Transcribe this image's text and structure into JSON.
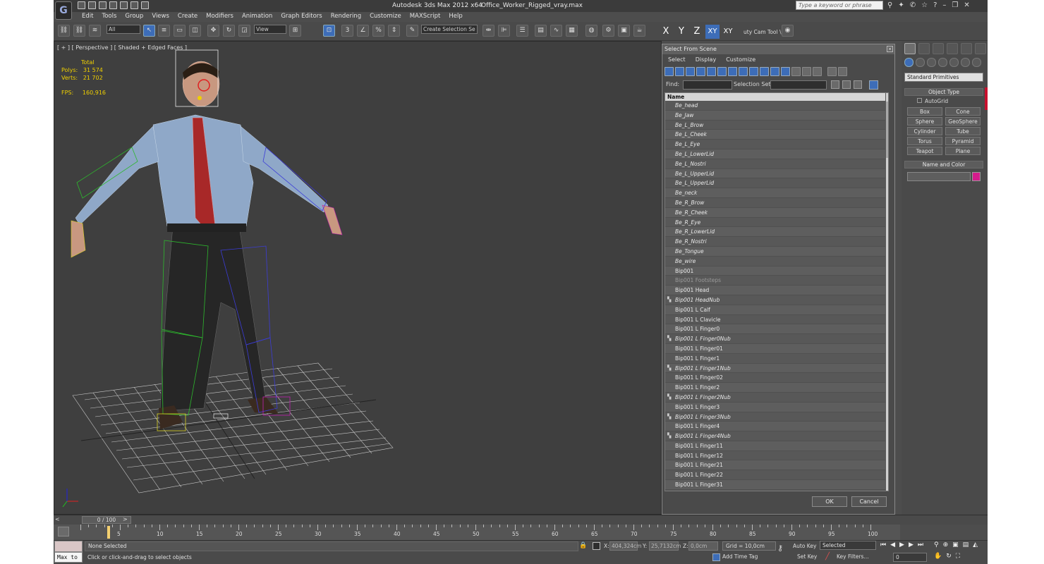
{
  "app": {
    "title": "Autodesk 3ds Max  2012 x64",
    "file": "Office_Worker_Rigged_vray.max",
    "search_placeholder": "Type a keyword or phrase"
  },
  "menu": [
    "Edit",
    "Tools",
    "Group",
    "Views",
    "Create",
    "Modifiers",
    "Animation",
    "Graph Editors",
    "Rendering",
    "Customize",
    "MAXScript",
    "Help"
  ],
  "toolbar": {
    "filter_value": "All",
    "refcoord_value": "View",
    "selection_set_value": "Create Selection Se",
    "axis_x": "X",
    "axis_y": "Y",
    "axis_z": "Z",
    "axis_xy": "XY",
    "axis_xy2": "XY",
    "cam_tool_label": "uty Cam Tool \\"
  },
  "viewport": {
    "label": "[ + ] [ Perspective ] [ Shaded + Edged Faces ]",
    "stats_header": "Total",
    "polys_label": "Polys:",
    "polys_value": "31 574",
    "verts_label": "Verts:",
    "verts_value": "21 702",
    "fps_label": "FPS:",
    "fps_value": "160,916"
  },
  "dialog": {
    "title": "Select From Scene",
    "menu": [
      "Select",
      "Display",
      "Customize"
    ],
    "find_label": "Find:",
    "selection_set_label": "Selection Set:",
    "column_name": "Name",
    "ok": "OK",
    "cancel": "Cancel",
    "rows": [
      {
        "name": "Be_head",
        "style": "it",
        "icon": ""
      },
      {
        "name": "Be_Jaw",
        "style": "it",
        "icon": ""
      },
      {
        "name": "Be_L_Brow",
        "style": "it",
        "icon": ""
      },
      {
        "name": "Be_L_Cheek",
        "style": "it",
        "icon": ""
      },
      {
        "name": "Be_L_Eye",
        "style": "it",
        "icon": ""
      },
      {
        "name": "Be_L_LowerLid",
        "style": "it",
        "icon": ""
      },
      {
        "name": "Be_L_Nostri",
        "style": "it",
        "icon": ""
      },
      {
        "name": "Be_L_UpperLid",
        "style": "it",
        "icon": ""
      },
      {
        "name": "Be_L_UpperLid",
        "style": "it",
        "icon": ""
      },
      {
        "name": "Be_neck",
        "style": "it",
        "icon": ""
      },
      {
        "name": "Be_R_Brow",
        "style": "it",
        "icon": ""
      },
      {
        "name": "Be_R_Cheek",
        "style": "it",
        "icon": ""
      },
      {
        "name": "Be_R_Eye",
        "style": "it",
        "icon": ""
      },
      {
        "name": "Be_R_LowerLid",
        "style": "it",
        "icon": ""
      },
      {
        "name": "Be_R_Nostri",
        "style": "it",
        "icon": ""
      },
      {
        "name": "Be_Tongue",
        "style": "it",
        "icon": ""
      },
      {
        "name": "Be_wire",
        "style": "it",
        "icon": ""
      },
      {
        "name": "Bip001",
        "style": "",
        "icon": ""
      },
      {
        "name": "Bip001 Footsteps",
        "style": "dim",
        "icon": ""
      },
      {
        "name": "Bip001 Head",
        "style": "",
        "icon": ""
      },
      {
        "name": "Bip001 HeadNub",
        "style": "it",
        "icon": "▚"
      },
      {
        "name": "Bip001 L Calf",
        "style": "",
        "icon": ""
      },
      {
        "name": "Bip001 L Clavicle",
        "style": "",
        "icon": ""
      },
      {
        "name": "Bip001 L Finger0",
        "style": "",
        "icon": ""
      },
      {
        "name": "Bip001 L Finger0Nub",
        "style": "it",
        "icon": "▚"
      },
      {
        "name": "Bip001 L Finger01",
        "style": "",
        "icon": ""
      },
      {
        "name": "Bip001 L Finger1",
        "style": "",
        "icon": ""
      },
      {
        "name": "Bip001 L Finger1Nub",
        "style": "it",
        "icon": "▚"
      },
      {
        "name": "Bip001 L Finger02",
        "style": "",
        "icon": ""
      },
      {
        "name": "Bip001 L Finger2",
        "style": "",
        "icon": ""
      },
      {
        "name": "Bip001 L Finger2Nub",
        "style": "it",
        "icon": "▚"
      },
      {
        "name": "Bip001 L Finger3",
        "style": "",
        "icon": ""
      },
      {
        "name": "Bip001 L Finger3Nub",
        "style": "it",
        "icon": "▚"
      },
      {
        "name": "Bip001 L Finger4",
        "style": "",
        "icon": ""
      },
      {
        "name": "Bip001 L Finger4Nub",
        "style": "it",
        "icon": "▚"
      },
      {
        "name": "Bip001 L Finger11",
        "style": "",
        "icon": ""
      },
      {
        "name": "Bip001 L Finger12",
        "style": "",
        "icon": ""
      },
      {
        "name": "Bip001 L Finger21",
        "style": "",
        "icon": ""
      },
      {
        "name": "Bip001 L Finger22",
        "style": "",
        "icon": ""
      },
      {
        "name": "Bip001 L Finger31",
        "style": "",
        "icon": ""
      }
    ]
  },
  "command_panel": {
    "primitives_value": "Standard Primitives",
    "object_type_header": "Object Type",
    "autogrid_label": "AutoGrid",
    "buttons": [
      "Box",
      "Cone",
      "Sphere",
      "GeoSphere",
      "Cylinder",
      "Tube",
      "Torus",
      "Pyramid",
      "Teapot",
      "Plane"
    ],
    "name_color_header": "Name and Color",
    "color": "#d41c8c"
  },
  "timeline": {
    "slider_text": "0 / 100",
    "ticks": [
      "5",
      "10",
      "15",
      "20",
      "25",
      "30",
      "35",
      "40",
      "45",
      "50",
      "55",
      "60",
      "65",
      "70",
      "75",
      "80",
      "85",
      "90",
      "95",
      "100"
    ]
  },
  "status": {
    "maxscript_label": "Max to",
    "selection_text": "None Selected",
    "prompt_text": "Click or click-and-drag to select objects",
    "x_label": "X:",
    "x_value": "404,324cm",
    "y_label": "Y:",
    "y_value": "25,7132cm",
    "z_label": "Z:",
    "z_value": "0,0cm",
    "grid_text": "Grid = 10,0cm",
    "add_time_tag": "Add Time Tag",
    "auto_key": "Auto Key",
    "set_key": "Set Key",
    "selected_dd": "Selected",
    "key_filters": "Key Filters...",
    "frame_value": "0"
  }
}
